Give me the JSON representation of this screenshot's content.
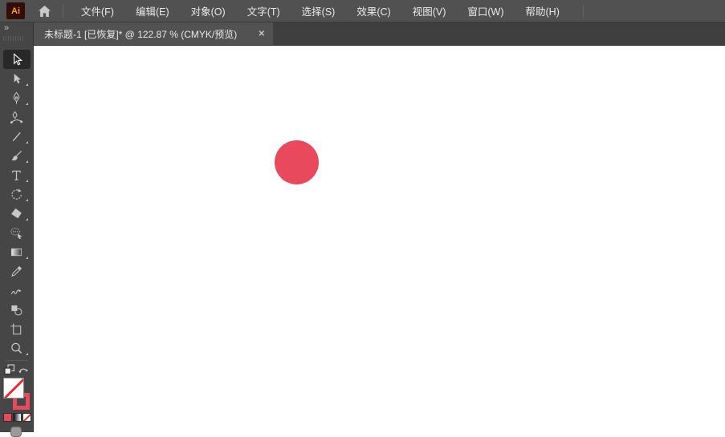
{
  "app": {
    "name": "Adobe Illustrator",
    "logo_text": "Ai",
    "theme": {
      "menubar_bg": "#515151",
      "tabbar_bg": "#3f3f3f",
      "tab_active_bg": "#525252",
      "toolbar_bg": "#464646",
      "tool_selected_bg": "#282828",
      "icon_color": "#c7c7c7",
      "accent_red": "#e8495c",
      "canvas_bg": "#ffffff"
    }
  },
  "menubar": {
    "items": [
      "文件(F)",
      "编辑(E)",
      "对象(O)",
      "文字(T)",
      "选择(S)",
      "效果(C)",
      "视图(V)",
      "窗口(W)",
      "帮助(H)"
    ]
  },
  "document_tab": {
    "title": "未标题-1 [已恢复]* @ 122.87 % (CMYK/预览)",
    "doc_name": "未标题-1",
    "recovered_flag": "[已恢复]*",
    "zoom_percent": "122.87 %",
    "color_mode": "CMYK/预览",
    "close": "✕"
  },
  "toolbar": {
    "collapse_icon": "»",
    "tools": [
      {
        "name": "selection-tool",
        "selected": true,
        "flyout": false
      },
      {
        "name": "direct-selection-tool",
        "selected": false,
        "flyout": true
      },
      {
        "name": "pen-tool",
        "selected": false,
        "flyout": true
      },
      {
        "name": "curvature-tool",
        "selected": false,
        "flyout": false
      },
      {
        "name": "line-segment-tool",
        "selected": false,
        "flyout": true
      },
      {
        "name": "paintbrush-tool",
        "selected": false,
        "flyout": true
      },
      {
        "name": "type-tool",
        "selected": false,
        "flyout": true
      },
      {
        "name": "rotate-tool",
        "selected": false,
        "flyout": true
      },
      {
        "name": "eraser-tool",
        "selected": false,
        "flyout": true
      },
      {
        "name": "comment-tool",
        "selected": false,
        "flyout": false
      },
      {
        "name": "gradient-tool",
        "selected": false,
        "flyout": true
      },
      {
        "name": "eyedropper-tool",
        "selected": false,
        "flyout": false
      },
      {
        "name": "shaper-tool",
        "selected": false,
        "flyout": false
      },
      {
        "name": "shape-builder-tool",
        "selected": false,
        "flyout": false
      },
      {
        "name": "artboard-tool",
        "selected": false,
        "flyout": false
      },
      {
        "name": "zoom-tool",
        "selected": false,
        "flyout": true
      }
    ],
    "fill_stroke": {
      "fill": "none",
      "stroke": "#e8495c"
    },
    "swatches": {
      "color": "#e8495c",
      "gradient": "linear-gradient(90deg,#0a0a0a,#ffffff)",
      "none": "#ffffff"
    }
  },
  "artboard": {
    "shape": {
      "type": "ellipse",
      "fill": "#e8495c"
    }
  }
}
